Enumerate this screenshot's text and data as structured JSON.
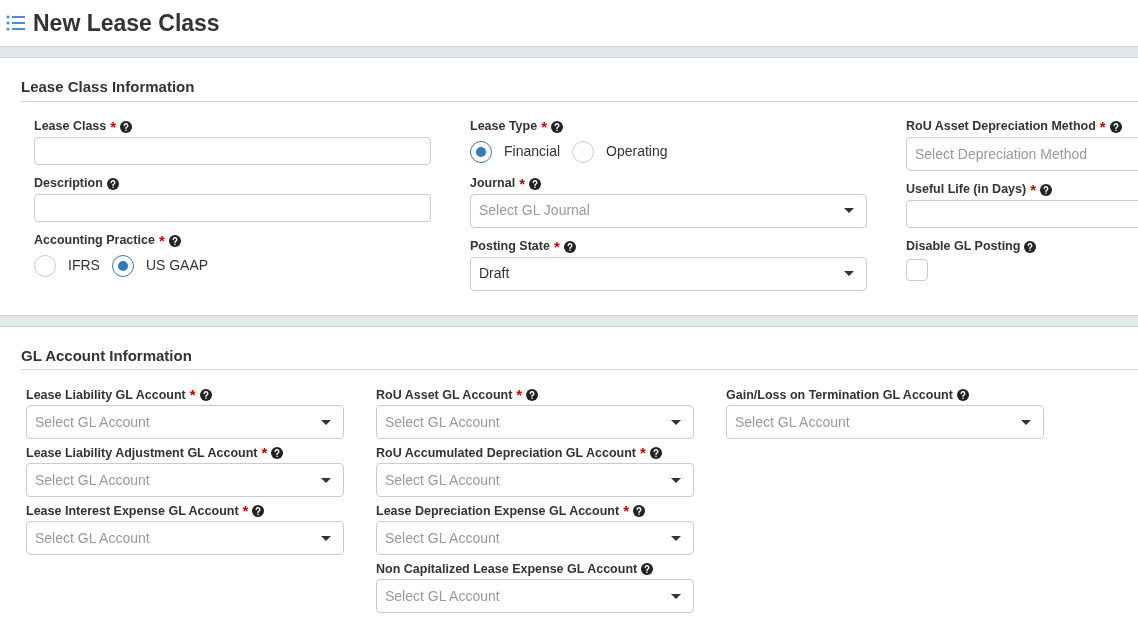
{
  "page": {
    "title": "New Lease Class"
  },
  "sections": [
    {
      "title": "Lease Class Information",
      "kind": "wide",
      "columns": [
        [
          {
            "kind": "text",
            "label": "Lease Class",
            "required_mark": "*"
          },
          {
            "kind": "text",
            "label": "Description"
          },
          {
            "kind": "radio",
            "label": "Accounting Practice",
            "required_mark": "*",
            "options": [
              {
                "label": "IFRS",
                "selected": false
              },
              {
                "label": "US GAAP",
                "selected": true
              }
            ]
          }
        ],
        [
          {
            "kind": "radio",
            "label": "Lease Type",
            "required_mark": "*",
            "options": [
              {
                "label": "Financial",
                "selected": true
              },
              {
                "label": "Operating",
                "selected": false
              }
            ]
          },
          {
            "kind": "select",
            "label": "Journal",
            "required_mark": "*",
            "placeholder": "Select GL Journal"
          },
          {
            "kind": "select",
            "label": "Posting State",
            "required_mark": "*",
            "value": "Draft"
          }
        ],
        [
          {
            "kind": "text",
            "label": "RoU Asset Depreciation Method",
            "required_mark": "*",
            "placeholder": "Select Depreciation Method"
          },
          {
            "kind": "text",
            "label": "Useful Life (in Days)",
            "required_mark": "*"
          },
          {
            "kind": "checkbox",
            "label": "Disable GL Posting",
            "checked": false
          }
        ]
      ]
    },
    {
      "title": "GL Account Information",
      "kind": "narrow",
      "columns": [
        [
          {
            "kind": "select",
            "label": "Lease Liability GL Account",
            "required_mark": "*",
            "placeholder": "Select GL Account"
          },
          {
            "kind": "select",
            "label": "Lease Liability Adjustment GL Account",
            "required_mark": "*",
            "placeholder": "Select GL Account"
          },
          {
            "kind": "select",
            "label": "Lease Interest Expense GL Account",
            "required_mark": "*",
            "placeholder": "Select GL Account"
          }
        ],
        [
          {
            "kind": "select",
            "label": "RoU Asset GL Account",
            "required_mark": "*",
            "placeholder": "Select GL Account"
          },
          {
            "kind": "select",
            "label": "RoU Accumulated Depreciation GL Account",
            "required_mark": "*",
            "placeholder": "Select GL Account"
          },
          {
            "kind": "select",
            "label": "Lease Depreciation Expense GL Account",
            "required_mark": "*",
            "placeholder": "Select GL Account"
          },
          {
            "kind": "select",
            "label": "Non Capitalized Lease Expense GL Account",
            "placeholder": "Select GL Account"
          }
        ],
        [
          {
            "kind": "select",
            "label": "Gain/Loss on Termination GL Account",
            "placeholder": "Select GL Account"
          }
        ]
      ]
    }
  ]
}
